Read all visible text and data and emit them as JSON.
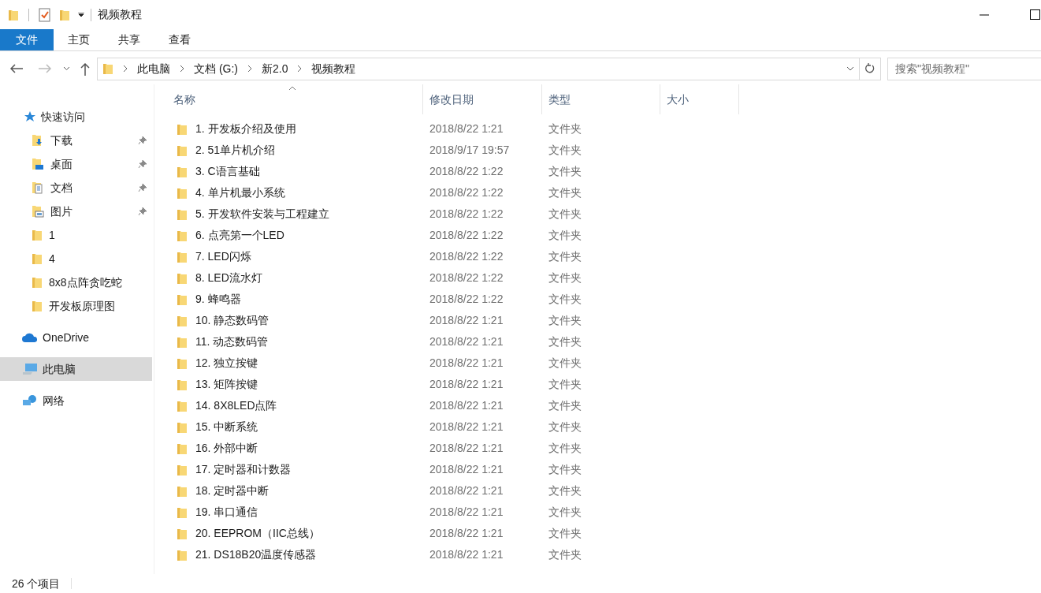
{
  "window": {
    "title": "视频教程"
  },
  "ribbon_tabs": [
    {
      "label": "文件",
      "selected": true
    },
    {
      "label": "主页",
      "selected": false
    },
    {
      "label": "共享",
      "selected": false
    },
    {
      "label": "查看",
      "selected": false
    }
  ],
  "address": {
    "segments": [
      "此电脑",
      "文档 (G:)",
      "新2.0",
      "视频教程"
    ]
  },
  "search": {
    "placeholder": "搜索\"视频教程\""
  },
  "sidebar": [
    {
      "label": "快速访问",
      "kind": "star",
      "selected": false,
      "children": [
        {
          "label": "下载",
          "kind": "downloads",
          "pinned": true
        },
        {
          "label": "桌面",
          "kind": "desktop",
          "pinned": true
        },
        {
          "label": "文档",
          "kind": "documents",
          "pinned": true
        },
        {
          "label": "图片",
          "kind": "pictures",
          "pinned": true
        },
        {
          "label": "1",
          "kind": "folder",
          "pinned": false
        },
        {
          "label": "4",
          "kind": "folder",
          "pinned": false
        },
        {
          "label": "8x8点阵贪吃蛇",
          "kind": "folder",
          "pinned": false
        },
        {
          "label": "开发板原理图",
          "kind": "folder",
          "pinned": false
        }
      ]
    },
    {
      "label": "OneDrive",
      "kind": "cloud",
      "selected": false
    },
    {
      "label": "此电脑",
      "kind": "pc",
      "selected": true
    },
    {
      "label": "网络",
      "kind": "network",
      "selected": false
    }
  ],
  "table": {
    "columns": [
      {
        "label": "名称",
        "sorted": true
      },
      {
        "label": "修改日期",
        "sorted": false
      },
      {
        "label": "类型",
        "sorted": false
      },
      {
        "label": "大小",
        "sorted": false
      }
    ],
    "rows": [
      {
        "name": "1. 开发板介绍及使用",
        "date": "2018/8/22 1:21",
        "type": "文件夹"
      },
      {
        "name": "2. 51单片机介绍",
        "date": "2018/9/17 19:57",
        "type": "文件夹"
      },
      {
        "name": "3. C语言基础",
        "date": "2018/8/22 1:22",
        "type": "文件夹"
      },
      {
        "name": "4. 单片机最小系统",
        "date": "2018/8/22 1:22",
        "type": "文件夹"
      },
      {
        "name": "5. 开发软件安装与工程建立",
        "date": "2018/8/22 1:22",
        "type": "文件夹"
      },
      {
        "name": "6. 点亮第一个LED",
        "date": "2018/8/22 1:22",
        "type": "文件夹"
      },
      {
        "name": "7. LED闪烁",
        "date": "2018/8/22 1:22",
        "type": "文件夹"
      },
      {
        "name": "8. LED流水灯",
        "date": "2018/8/22 1:22",
        "type": "文件夹"
      },
      {
        "name": "9. 蜂鸣器",
        "date": "2018/8/22 1:22",
        "type": "文件夹"
      },
      {
        "name": "10. 静态数码管",
        "date": "2018/8/22 1:21",
        "type": "文件夹"
      },
      {
        "name": "11. 动态数码管",
        "date": "2018/8/22 1:21",
        "type": "文件夹"
      },
      {
        "name": "12. 独立按键",
        "date": "2018/8/22 1:21",
        "type": "文件夹"
      },
      {
        "name": "13. 矩阵按键",
        "date": "2018/8/22 1:21",
        "type": "文件夹"
      },
      {
        "name": "14. 8X8LED点阵",
        "date": "2018/8/22 1:21",
        "type": "文件夹"
      },
      {
        "name": "15. 中断系统",
        "date": "2018/8/22 1:21",
        "type": "文件夹"
      },
      {
        "name": "16. 外部中断",
        "date": "2018/8/22 1:21",
        "type": "文件夹"
      },
      {
        "name": "17. 定时器和计数器",
        "date": "2018/8/22 1:21",
        "type": "文件夹"
      },
      {
        "name": "18. 定时器中断",
        "date": "2018/8/22 1:21",
        "type": "文件夹"
      },
      {
        "name": "19. 串口通信",
        "date": "2018/8/22 1:21",
        "type": "文件夹"
      },
      {
        "name": "20. EEPROM（IIC总线）",
        "date": "2018/8/22 1:21",
        "type": "文件夹"
      },
      {
        "name": "21. DS18B20温度传感器",
        "date": "2018/8/22 1:21",
        "type": "文件夹"
      }
    ]
  },
  "status_bar": {
    "count": "26 个项目"
  }
}
